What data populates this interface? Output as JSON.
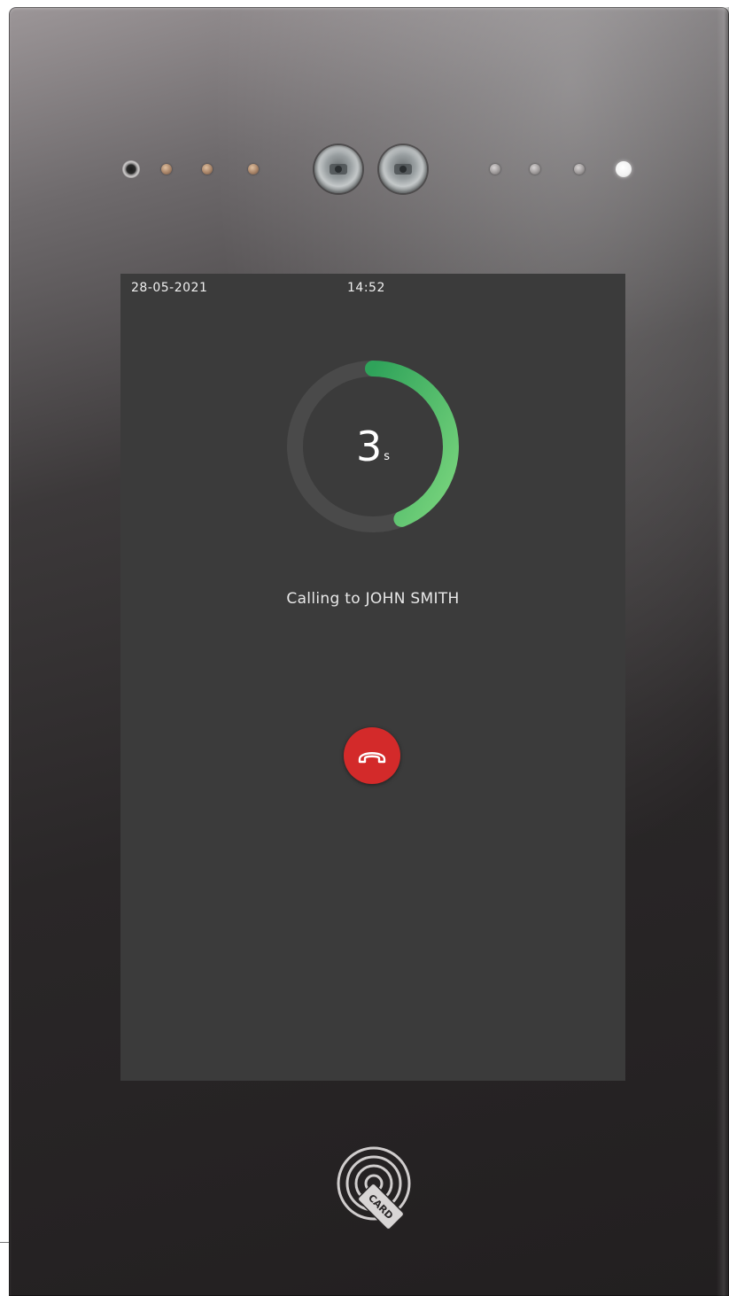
{
  "status_bar": {
    "date": "28-05-2021",
    "time": "14:52"
  },
  "call": {
    "countdown_value": "3",
    "countdown_unit": "s",
    "countdown_progress": 0.44,
    "calling_text": "Calling to JOHN SMITH",
    "hangup_icon": "phone-hangup-icon"
  },
  "card_reader": {
    "label": "CARD",
    "icon": "contactless-card-icon"
  },
  "colors": {
    "screen_background": "#3b3b3b",
    "ring_progress_start": "#2fa35a",
    "ring_progress_end": "#7bd67e",
    "ring_track": "#4a4a4a",
    "hangup_button": "#d32a2a"
  }
}
